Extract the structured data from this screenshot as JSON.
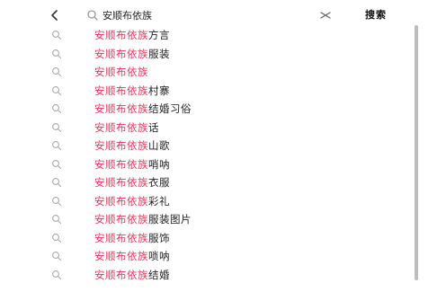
{
  "header": {
    "back_icon": "chevron-left-icon",
    "search_icon": "search-icon",
    "query": "安顺布依族",
    "clear_icon": "close-icon",
    "search_label": "搜索"
  },
  "colors": {
    "highlight": "#e8335a",
    "text": "#222222",
    "icon": "#999999"
  },
  "suggestions": [
    {
      "highlight": "安顺布依族",
      "rest": "方言"
    },
    {
      "highlight": "安顺布依族",
      "rest": "服装"
    },
    {
      "highlight": "安顺布依族",
      "rest": ""
    },
    {
      "highlight": "安顺布依族",
      "rest": "村寨"
    },
    {
      "highlight": "安顺布依族",
      "rest": "结婚习俗"
    },
    {
      "highlight": "安顺布依族",
      "rest": "话"
    },
    {
      "highlight": "安顺布依族",
      "rest": "山歌"
    },
    {
      "highlight": "安顺布依族",
      "rest": "哨呐"
    },
    {
      "highlight": "安顺布依族",
      "rest": "衣服"
    },
    {
      "highlight": "安顺布依族",
      "rest": "彩礼"
    },
    {
      "highlight": "安顺布依族",
      "rest": "服装图片"
    },
    {
      "highlight": "安顺布依族",
      "rest": "服饰"
    },
    {
      "highlight": "安顺布依族",
      "rest": "唢呐"
    },
    {
      "highlight": "安顺布依族",
      "rest": "结婚"
    }
  ]
}
